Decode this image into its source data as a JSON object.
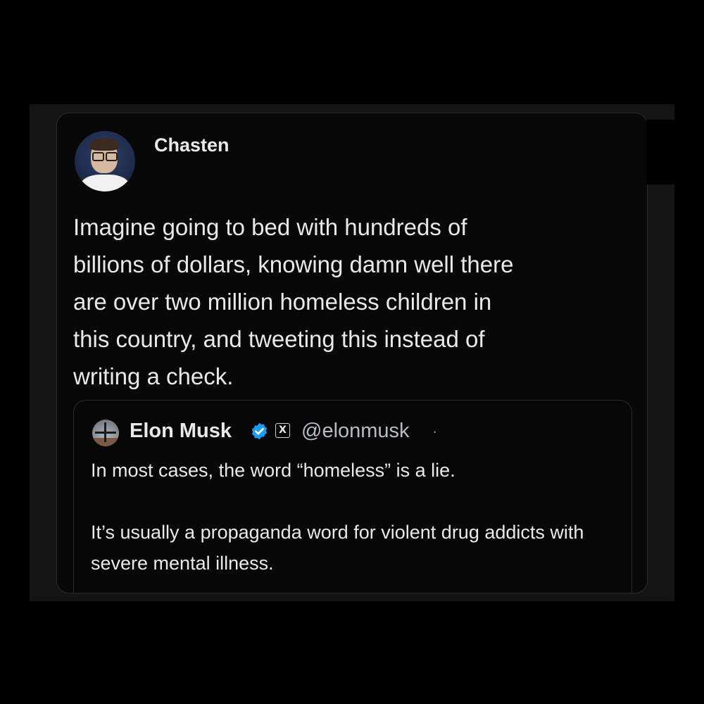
{
  "tweet": {
    "author": "Chasten",
    "avatar_icon": "profile-photo-avatar",
    "text": "Imagine going to bed with hundreds of\nbillions of dollars, knowing damn well there\nare over two million homeless children in\nthis country, and tweeting this instead of\nwriting a check."
  },
  "quoted_tweet": {
    "name": "Elon Musk",
    "verified_icon": "verified-badge-icon",
    "verified_color": "#1d9bf0",
    "x_badge_icon": "x-logo-icon",
    "x_badge_label": "X",
    "handle": "@elonmusk",
    "separator": "·",
    "paragraphs": [
      "In most cases, the word “homeless” is a lie.",
      "It’s usually a propaganda word for violent drug addicts with severe mental illness."
    ]
  },
  "colors": {
    "background": "#000000",
    "card": "#080808",
    "text": "#e7e9ea",
    "secondary_text": "#b8bdc2"
  }
}
